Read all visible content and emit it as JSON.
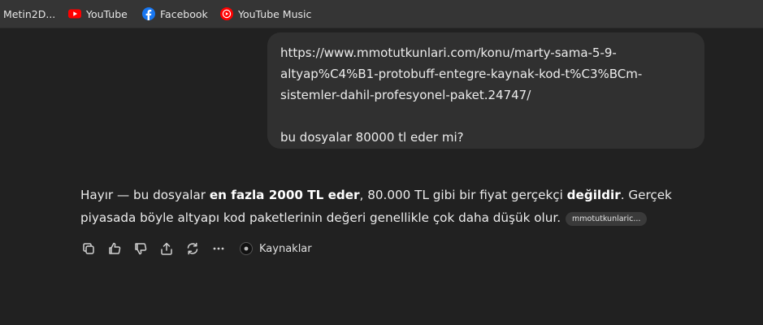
{
  "bookmarks": [
    {
      "label": "Metin2D...",
      "icon": "folder-icon"
    },
    {
      "label": "YouTube",
      "icon": "youtube-icon"
    },
    {
      "label": "Facebook",
      "icon": "facebook-icon"
    },
    {
      "label": "YouTube Music",
      "icon": "youtube-music-icon"
    }
  ],
  "user_message": {
    "text": "https://www.mmotutkunlari.com/konu/marty-sama-5-9-altyap%C4%B1-protobuff-entegre-kaynak-kod-t%C3%BCm-sistemler-dahil-profesyonel-paket.24747/\n\nbu dosyalar 80000 tl eder mi?"
  },
  "assistant_message": {
    "part1": "Hayır — bu dosyalar ",
    "bold1": "en fazla 2000 TL eder",
    "part2": ", 80.000 TL gibi bir fiyat gerçekçi ",
    "bold2": "değildir",
    "part3": ". Gerçek piyasada böyle altyapı kod paketlerinin değeri genellikle çok daha düşük olur.",
    "source_chip": "mmotutkunlaric..."
  },
  "actions": {
    "sources_label": "Kaynaklar"
  },
  "colors": {
    "background": "#212121",
    "bookmark_bar": "#353535",
    "user_bubble": "#303030",
    "youtube_red": "#ff0000",
    "facebook_blue": "#1877f2"
  }
}
